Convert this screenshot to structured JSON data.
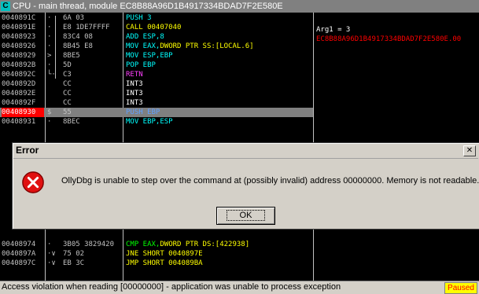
{
  "window": {
    "title": "CPU - main thread, module EC8B88A96D1B4917334BDAD7F2E580E",
    "icon_letter": "C",
    "icon": "cpu-window-icon"
  },
  "disasm_top": [
    {
      "addr": "0040891C",
      "mark": "·",
      "hex": "6A 03",
      "parts": [
        {
          "t": "PUSH 3",
          "c": "c-cyan"
        }
      ]
    },
    {
      "addr": "0040891E",
      "mark": "·",
      "hex": "E8 1DE7FFFF",
      "parts": [
        {
          "t": "CALL 00407040",
          "c": "c-yellow"
        }
      ]
    },
    {
      "addr": "00408923",
      "mark": "·",
      "hex": "83C4 08",
      "parts": [
        {
          "t": "ADD ESP,8",
          "c": "c-cyan"
        }
      ]
    },
    {
      "addr": "00408926",
      "mark": "·",
      "hex": "8B45 E8",
      "parts": [
        {
          "t": "MOV EAX,",
          "c": "c-cyan"
        },
        {
          "t": "DWORD PTR SS:[LOCAL.6]",
          "c": "c-yellow"
        }
      ]
    },
    {
      "addr": "00408929",
      "mark": ">",
      "hex": "8BE5",
      "parts": [
        {
          "t": "MOV ESP,EBP",
          "c": "c-cyan"
        }
      ]
    },
    {
      "addr": "0040892B",
      "mark": "·",
      "hex": "5D",
      "parts": [
        {
          "t": "POP EBP",
          "c": "c-cyan"
        }
      ]
    },
    {
      "addr": "0040892C",
      "mark": "└·",
      "hex": "C3",
      "parts": [
        {
          "t": "RETN",
          "c": "c-magenta"
        }
      ]
    },
    {
      "addr": "0040892D",
      "mark": "",
      "hex": "CC",
      "parts": [
        {
          "t": "INT3",
          "c": "c-white"
        }
      ]
    },
    {
      "addr": "0040892E",
      "mark": "",
      "hex": "CC",
      "parts": [
        {
          "t": "INT3",
          "c": "c-white"
        }
      ]
    },
    {
      "addr": "0040892F",
      "mark": "",
      "hex": "CC",
      "parts": [
        {
          "t": "INT3",
          "c": "c-white"
        }
      ]
    },
    {
      "addr": "00408930",
      "mark": "$",
      "hex": "55",
      "parts": [
        {
          "t": "PUSH EBP",
          "c": "c-sky"
        }
      ],
      "selected": true,
      "breakpoint": true
    },
    {
      "addr": "00408931",
      "mark": "·",
      "hex": "8BEC",
      "parts": [
        {
          "t": "MOV EBP,ESP",
          "c": "c-cyan"
        }
      ]
    }
  ],
  "disasm_bottom": [
    {
      "addr": "00408974",
      "mark": "·",
      "hex": "3B05 3829420",
      "parts": [
        {
          "t": "CMP EAX,",
          "c": "c-green"
        },
        {
          "t": "DWORD PTR DS:[422938]",
          "c": "c-yellow"
        }
      ]
    },
    {
      "addr": "0040897A",
      "mark": "·∨",
      "hex": "75 02",
      "parts": [
        {
          "t": "JNE SHORT 0040897E",
          "c": "c-yellow"
        }
      ]
    },
    {
      "addr": "0040897C",
      "mark": "·∨",
      "hex": "EB 3C",
      "parts": [
        {
          "t": "JMP SHORT 004089BA",
          "c": "c-yellow"
        }
      ]
    }
  ],
  "comments": {
    "arg_label": "Arg1 = 3",
    "call_target": "EC8B88A96D1B4917334BDAD7F2E580E.00"
  },
  "dialog": {
    "title": "Error",
    "close_label": "✕",
    "message": "OllyDbg is unable to step over the command at (possibly invalid) address 00000000. Memory is not readable.",
    "ok_label": "OK",
    "icon": "error-icon"
  },
  "status": {
    "message": "Access violation when reading [00000000] - application was unable to process exception",
    "state": "Paused"
  },
  "colors": {
    "accent_selected": "#808080",
    "breakpoint": "#ff0000",
    "paused_bg": "#ffff00",
    "paused_fg": "#ff0000"
  }
}
